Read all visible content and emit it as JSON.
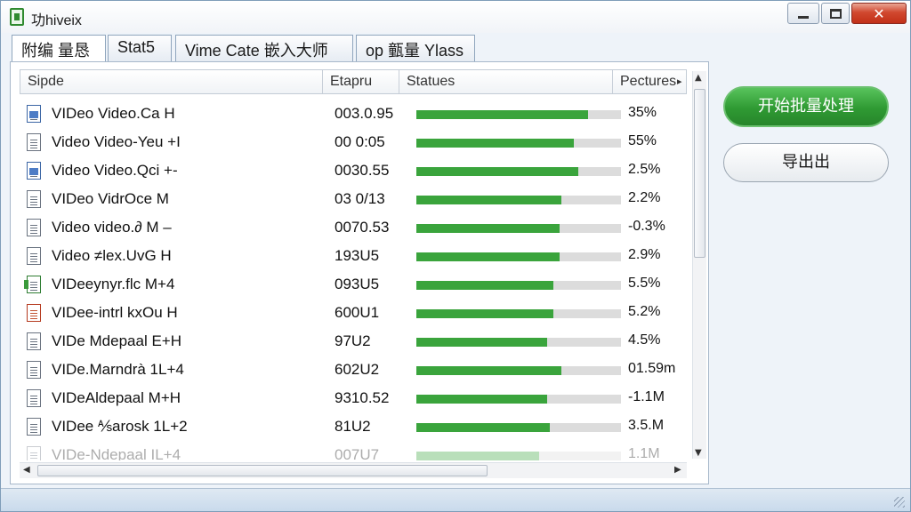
{
  "window": {
    "title": "功hiveix"
  },
  "tabs": [
    {
      "label": "附编 量恳"
    },
    {
      "label": "Stat5"
    },
    {
      "label": "Vime Cate 嵌入大师"
    },
    {
      "label": "op 㼿量 Ylass"
    }
  ],
  "columns": {
    "name": "Sipde",
    "duration": "Etapru",
    "status": "Statues",
    "progress": "Pectures"
  },
  "rows": [
    {
      "icon": "video-file-icon",
      "name": "VIDeo Video.Ca H",
      "duration": "003.0.95",
      "progress": 0.84,
      "label": "35%"
    },
    {
      "icon": "document-icon",
      "name": "Video Video-Yeu +I",
      "duration": "00 0:05",
      "progress": 0.77,
      "label": "55%"
    },
    {
      "icon": "video-file-icon",
      "name": "Video Video.Qci +-",
      "duration": "0030.55",
      "progress": 0.79,
      "label": "2.5%"
    },
    {
      "icon": "document-icon",
      "name": "VIDeo VidrOce M",
      "duration": "03 0/13",
      "progress": 0.71,
      "label": "2.2%"
    },
    {
      "icon": "document-icon",
      "name": "Video video.∂ M –",
      "duration": "0070.53",
      "progress": 0.7,
      "label": "-0.3%"
    },
    {
      "icon": "document-icon",
      "name": "Video ≠lex.UvG H",
      "duration": "193U5",
      "progress": 0.7,
      "label": "2.9%"
    },
    {
      "icon": "green-file-icon",
      "name": "VIDeeynyr.flc M+4",
      "duration": "093U5",
      "progress": 0.67,
      "label": "5.5%"
    },
    {
      "icon": "red-file-icon",
      "name": "VIDee-intrl kxOu H",
      "duration": "600U1",
      "progress": 0.67,
      "label": "5.2%"
    },
    {
      "icon": "document-icon",
      "name": "VIDe Mdepaal E+H",
      "duration": "97U2",
      "progress": 0.64,
      "label": "4.5%"
    },
    {
      "icon": "document-icon",
      "name": "VIDe.Marndrà 1L+4",
      "duration": "602U2",
      "progress": 0.71,
      "label": "01.59m"
    },
    {
      "icon": "document-icon",
      "name": "VIDeAldepaal M+H",
      "duration": "9310.52",
      "progress": 0.64,
      "label": "-1.1M"
    },
    {
      "icon": "document-icon",
      "name": "VIDee ⅍arosk 1L+2",
      "duration": "81U2",
      "progress": 0.65,
      "label": "3.5.M"
    },
    {
      "icon": "document-icon",
      "name": "VIDe-Ndepaal IL+4",
      "duration": "007U7",
      "progress": 0.6,
      "label": "1.1M"
    }
  ],
  "actions": {
    "start": "开始批量处理",
    "export": "导出出"
  },
  "colors": {
    "accent": "#3aa43c",
    "close": "#c23018"
  }
}
